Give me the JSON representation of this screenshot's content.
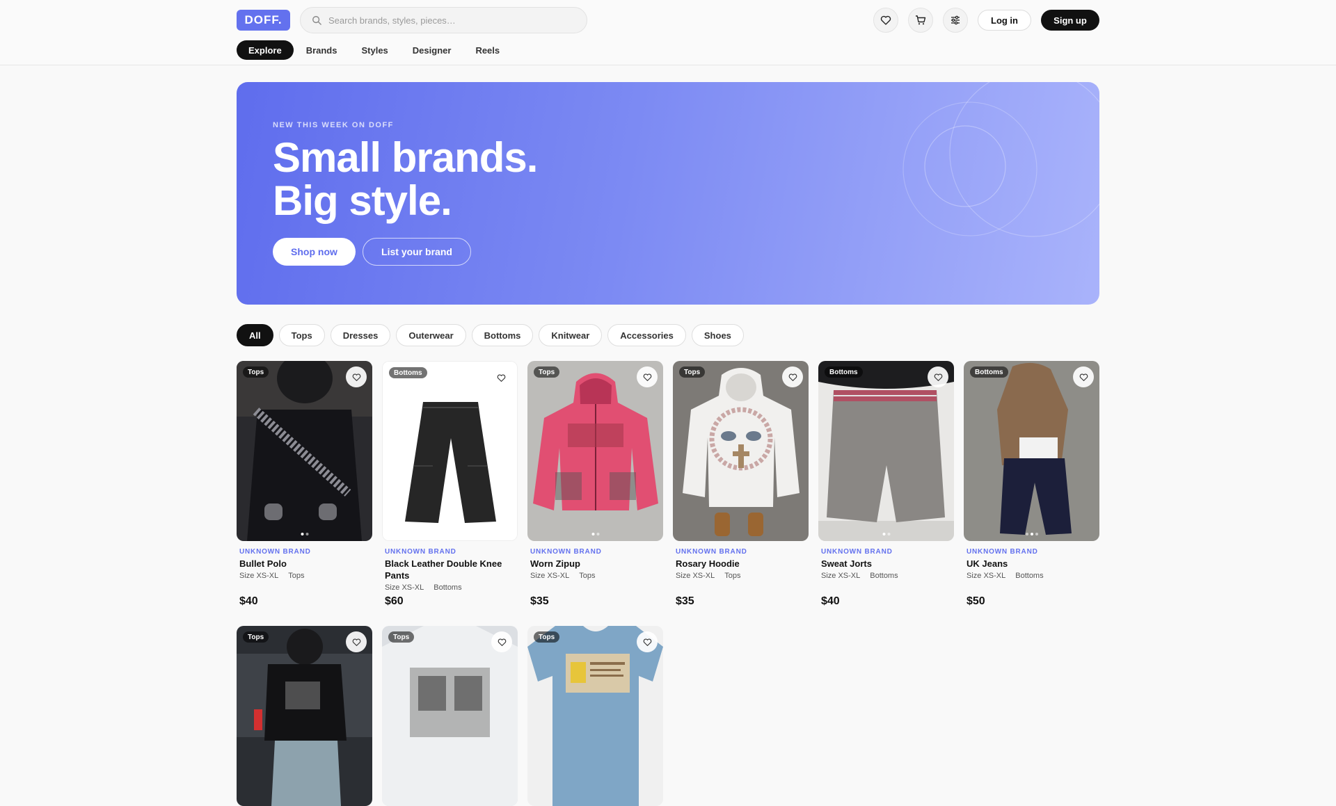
{
  "header": {
    "logo": "DOFF.",
    "search_placeholder": "Search brands, styles, pieces…",
    "login": "Log in",
    "signup": "Sign up",
    "icons": [
      "heart-icon",
      "cart-icon",
      "filter-sliders-icon"
    ]
  },
  "nav": [
    "Explore",
    "Brands",
    "Styles",
    "Designer",
    "Reels"
  ],
  "hero": {
    "kicker": "NEW THIS WEEK ON DOFF",
    "title_line1": "Small brands.",
    "title_line2": "Big style.",
    "primary": "Shop now",
    "secondary": "List your brand"
  },
  "filters": [
    "All",
    "Tops",
    "Dresses",
    "Outerwear",
    "Bottoms",
    "Knitwear",
    "Accessories",
    "Shoes"
  ],
  "products": [
    {
      "tag": "Tops",
      "brand": "UNKNOWN BRAND",
      "title": "Bullet Polo",
      "size": "Size XS-XL",
      "category": "Tops",
      "price": "$40"
    },
    {
      "tag": "Bottoms",
      "brand": "UNKNOWN BRAND",
      "title": "Black Leather Double Knee Pants",
      "size": "Size XS-XL",
      "category": "Bottoms",
      "price": "$60"
    },
    {
      "tag": "Tops",
      "brand": "UNKNOWN BRAND",
      "title": "Worn Zipup",
      "size": "Size XS-XL",
      "category": "Tops",
      "price": "$35"
    },
    {
      "tag": "Tops",
      "brand": "UNKNOWN BRAND",
      "title": "Rosary Hoodie",
      "size": "Size XS-XL",
      "category": "Tops",
      "price": "$35"
    },
    {
      "tag": "Bottoms",
      "brand": "UNKNOWN BRAND",
      "title": "Sweat Jorts",
      "size": "Size XS-XL",
      "category": "Bottoms",
      "price": "$40"
    },
    {
      "tag": "Bottoms",
      "brand": "UNKNOWN BRAND",
      "title": "UK Jeans",
      "size": "Size XS-XL",
      "category": "Bottoms",
      "price": "$50"
    },
    {
      "tag": "Tops"
    },
    {
      "tag": "Tops"
    },
    {
      "tag": "Tops"
    }
  ],
  "colors": {
    "accent": "#6371ee",
    "dark": "#111111"
  }
}
